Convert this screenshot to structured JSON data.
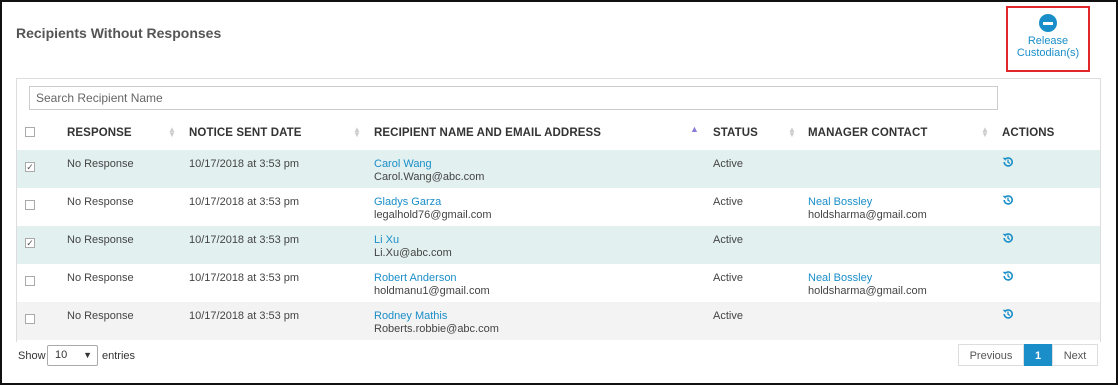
{
  "title": "Recipients Without Responses",
  "release_button": {
    "line1": "Release",
    "line2": "Custodian(s)"
  },
  "search": {
    "placeholder": "Search Recipient Name"
  },
  "columns": {
    "response": "RESPONSE",
    "notice_sent_date": "NOTICE SENT DATE",
    "recipient": "RECIPIENT NAME AND EMAIL ADDRESS",
    "status": "STATUS",
    "manager_contact": "MANAGER CONTACT",
    "actions": "ACTIONS"
  },
  "rows": [
    {
      "checked": true,
      "response": "No Response",
      "date": "10/17/2018 at 3:53 pm",
      "name": "Carol Wang",
      "email": "Carol.Wang@abc.com",
      "status": "Active",
      "manager_name": "",
      "manager_email": ""
    },
    {
      "checked": false,
      "response": "No Response",
      "date": "10/17/2018 at 3:53 pm",
      "name": "Gladys Garza",
      "email": "legalhold76@gmail.com",
      "status": "Active",
      "manager_name": "Neal Bossley",
      "manager_email": "holdsharma@gmail.com"
    },
    {
      "checked": true,
      "response": "No Response",
      "date": "10/17/2018 at 3:53 pm",
      "name": "Li Xu",
      "email": "Li.Xu@abc.com",
      "status": "Active",
      "manager_name": "",
      "manager_email": ""
    },
    {
      "checked": false,
      "response": "No Response",
      "date": "10/17/2018 at 3:53 pm",
      "name": "Robert Anderson",
      "email": "holdmanu1@gmail.com",
      "status": "Active",
      "manager_name": "Neal Bossley",
      "manager_email": "holdsharma@gmail.com"
    },
    {
      "checked": false,
      "response": "No Response",
      "date": "10/17/2018 at 3:53 pm",
      "name": "Rodney Mathis",
      "email": "Roberts.robbie@abc.com",
      "status": "Active",
      "manager_name": "",
      "manager_email": ""
    }
  ],
  "row_action_icon": "restore-icon",
  "footer": {
    "show_label": "Show",
    "page_size": "10",
    "entries_label": "entries",
    "prev_label": "Previous",
    "current_page": "1",
    "next_label": "Next"
  },
  "colors": {
    "accent": "#1a8ec8",
    "highlight_row": "#e3f0f0",
    "alt_row": "#f3f3f3",
    "release_border": "#e0262b"
  }
}
